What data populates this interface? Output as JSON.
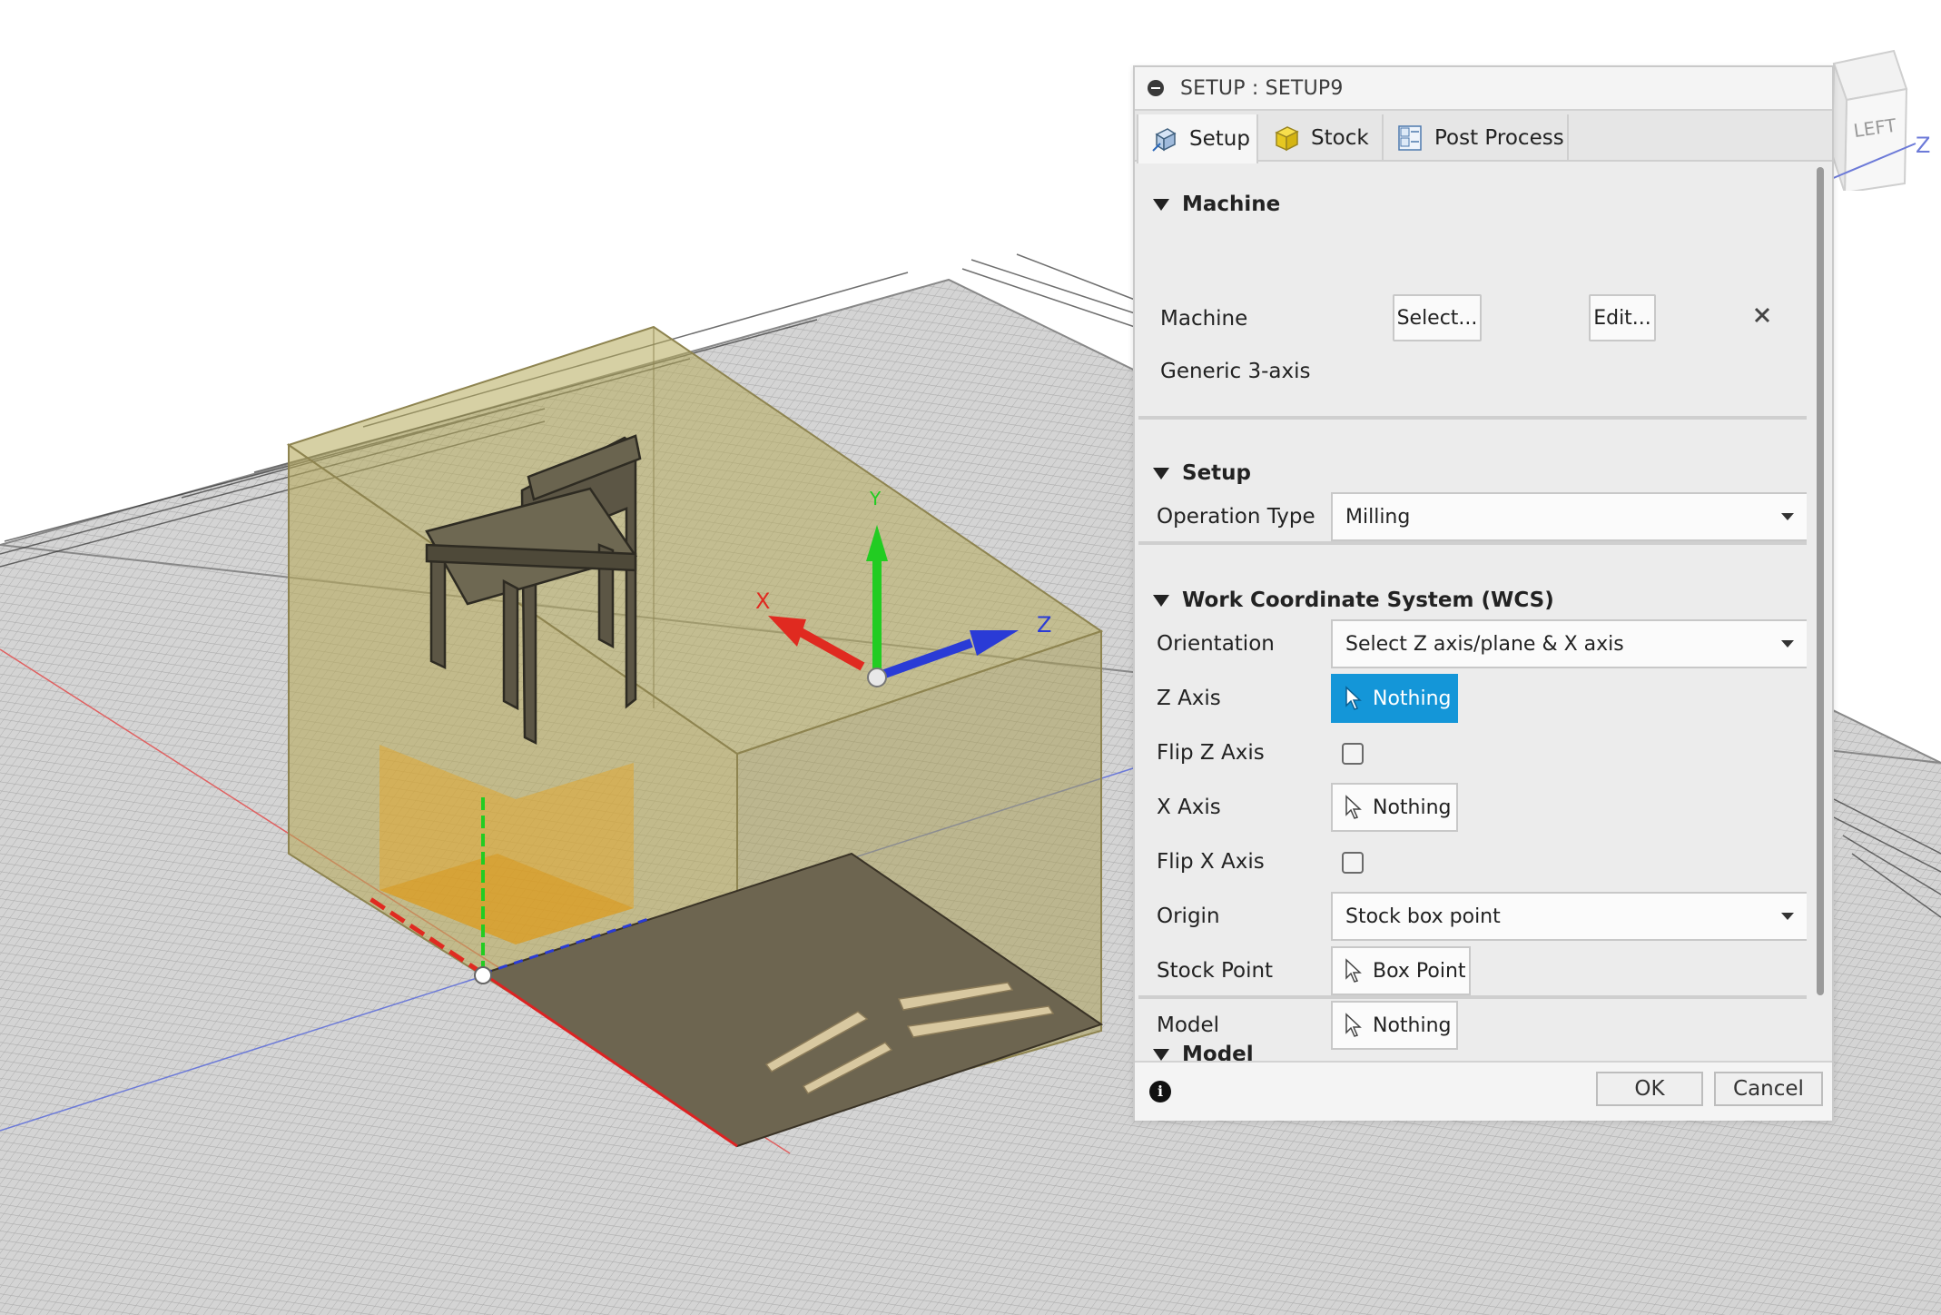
{
  "dialog": {
    "title": "SETUP : SETUP9",
    "tabs": [
      {
        "label": "Setup",
        "icon": "setup-icon",
        "active": true
      },
      {
        "label": "Stock",
        "icon": "stock-icon",
        "active": false
      },
      {
        "label": "Post Process",
        "icon": "post-process-icon",
        "active": false
      }
    ],
    "machine_section": {
      "header": "Machine",
      "machine_label": "Machine",
      "select_button": "Select...",
      "edit_button": "Edit...",
      "clear_icon": "close-icon",
      "machine_name": "Generic 3-axis"
    },
    "setup_section": {
      "header": "Setup",
      "operation_type_label": "Operation Type",
      "operation_type_value": "Milling"
    },
    "wcs_section": {
      "header": "Work Coordinate System (WCS)",
      "orientation_label": "Orientation",
      "orientation_value": "Select Z axis/plane & X axis",
      "z_axis_label": "Z Axis",
      "z_axis_value": "Nothing",
      "flip_z_label": "Flip Z Axis",
      "flip_z_checked": false,
      "x_axis_label": "X Axis",
      "x_axis_value": "Nothing",
      "flip_x_label": "Flip X Axis",
      "flip_x_checked": false,
      "origin_label": "Origin",
      "origin_value": "Stock box point",
      "stock_point_label": "Stock Point",
      "stock_point_value": "Box Point"
    },
    "model_section": {
      "header": "Model",
      "model_label": "Model",
      "model_value": "Nothing"
    },
    "footer": {
      "info_icon": "info-icon",
      "ok_button": "OK",
      "cancel_button": "Cancel"
    }
  },
  "viewport": {
    "axis_labels": {
      "x": "X",
      "y": "Y",
      "z": "Z"
    },
    "viewcube_face": "LEFT",
    "viewcube_axis": "Z",
    "colors": {
      "x_axis": "#e02a20",
      "y_axis": "#22cc22",
      "z_axis": "#2a3bd6",
      "highlight": "#1496d8",
      "stock_box": "#b5a95a",
      "ground_plate": "#6d6550"
    }
  }
}
